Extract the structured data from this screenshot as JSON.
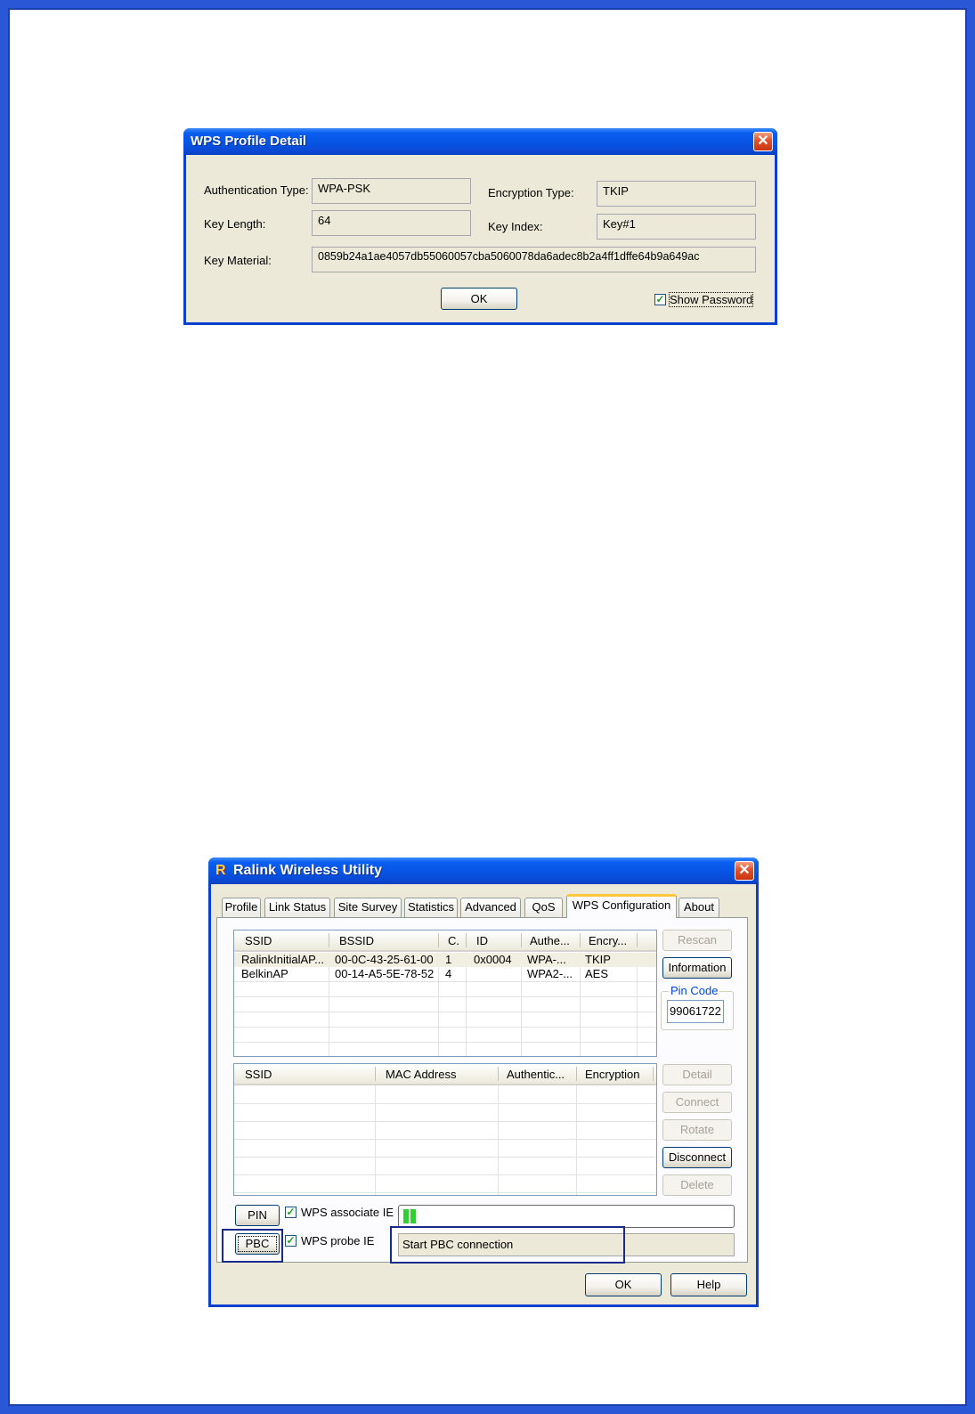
{
  "wps_profile_detail": {
    "title": "WPS Profile Detail",
    "close": "✕",
    "labels": {
      "authentication_type": "Authentication Type:",
      "encryption_type": "Encryption Type:",
      "key_length": "Key Length:",
      "key_index": "Key Index:",
      "key_material": "Key Material:"
    },
    "values": {
      "authentication_type": "WPA-PSK",
      "encryption_type": "TKIP",
      "key_length": "64",
      "key_index": "Key#1",
      "key_material": "0859b24a1ae4057db55060057cba5060078da6adec8b2a4ff1dffe64b9a649ac"
    },
    "ok_button": "OK",
    "show_password": {
      "label": "Show Password",
      "checked": true
    }
  },
  "ralink_utility": {
    "title": "Ralink Wireless Utility",
    "close": "✕",
    "tabs": [
      "Profile",
      "Link Status",
      "Site Survey",
      "Statistics",
      "Advanced",
      "QoS",
      "WPS Configuration",
      "About"
    ],
    "active_tab": "WPS Configuration",
    "ap_list": {
      "columns": [
        "SSID",
        "BSSID",
        "C.",
        "ID",
        "Authe...",
        "Encry..."
      ],
      "rows": [
        [
          "RalinkInitialAP...",
          "00-0C-43-25-61-00",
          "1",
          "0x0004",
          "WPA-...",
          "TKIP"
        ],
        [
          "BelkinAP",
          "00-14-A5-5E-78-52",
          "4",
          "",
          "WPA2-...",
          "AES"
        ]
      ]
    },
    "side_buttons_top": {
      "rescan": "Rescan",
      "information": "Information"
    },
    "pin_code": {
      "label": "Pin Code",
      "value": "99061722"
    },
    "profile_list": {
      "columns": [
        "SSID",
        "MAC Address",
        "Authentic...",
        "Encryption"
      ]
    },
    "side_buttons_bottom": {
      "detail": "Detail",
      "connect": "Connect",
      "rotate": "Rotate",
      "disconnect": "Disconnect",
      "delete": "Delete"
    },
    "pin_button": "PIN",
    "pbc_button": "PBC",
    "wps_associate_ie": {
      "label": "WPS associate IE",
      "checked": true
    },
    "wps_probe_ie": {
      "label": "WPS probe IE",
      "checked": true
    },
    "progress": {
      "segments_filled": 2
    },
    "status_text": "Start PBC connection",
    "ok_button": "OK",
    "help_button": "Help"
  },
  "colors": {
    "xp_blue": "#0a5ef0",
    "window_bg": "#ece9d8",
    "frame_blue": "#2a57d6",
    "progress_green": "#2fd12f"
  }
}
